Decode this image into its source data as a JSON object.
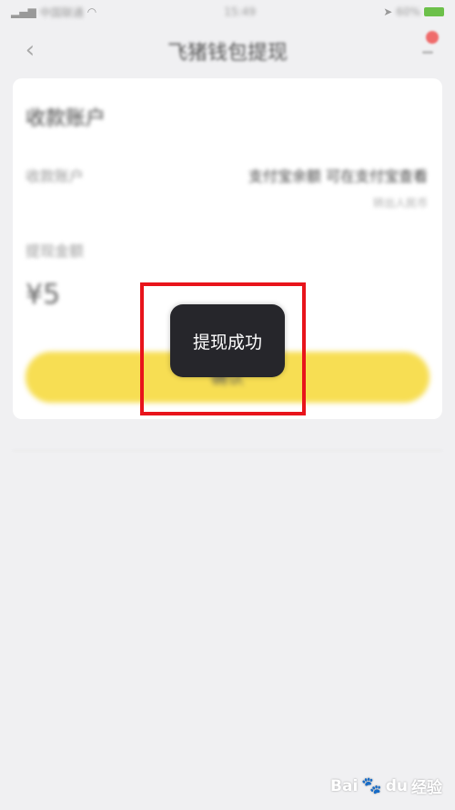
{
  "status_bar": {
    "carrier": "中国联通",
    "time": "15:49",
    "battery": "60%"
  },
  "nav": {
    "back_icon": "chevron-left-icon",
    "title": "飞猪钱包提现"
  },
  "card": {
    "title": "收款账户",
    "account_label": "收款账户",
    "account_value": "支付宝余额 可在支付宝查看",
    "account_sub": "转出人民币",
    "amount_label": "提现金额",
    "amount_value": "¥5",
    "button_label": "确认"
  },
  "toast": {
    "message": "提现成功"
  },
  "watermark": {
    "brand": "Bai",
    "brand2": "du",
    "sub": "经验"
  },
  "colors": {
    "accent_yellow": "#f7de53",
    "highlight_red": "#e8141b",
    "toast_bg": "#26262b",
    "page_bg": "#f0f0f2"
  }
}
